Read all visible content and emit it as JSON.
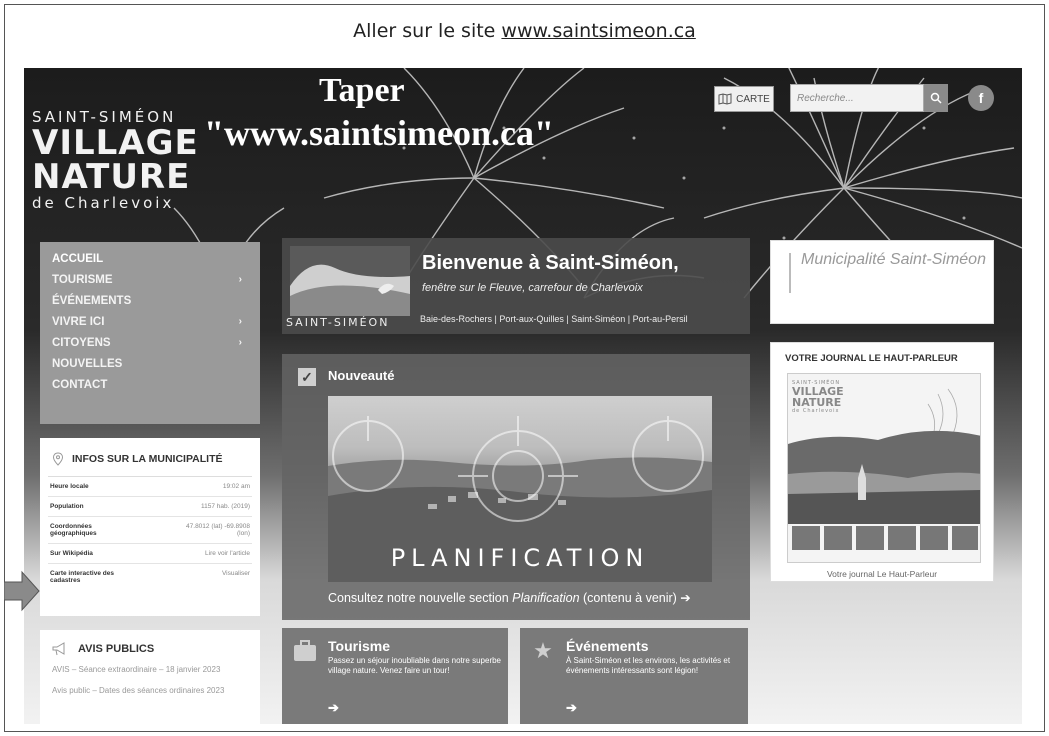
{
  "instruction": {
    "prefix": "Aller sur le site",
    "url": "www.saintsimeon.ca"
  },
  "overlay": {
    "taper": "Taper",
    "taper_url": "\"www.saintsimeon.ca\""
  },
  "logo": {
    "top": "SAINT-SIMÉON",
    "line1": "VILLAGE",
    "line2": "NATURE",
    "bottom": "de Charlevoix"
  },
  "header": {
    "carte_label": "CARTE",
    "search_placeholder": "Recherche...",
    "facebook_label": "f"
  },
  "nav": {
    "items": [
      {
        "label": "ACCUEIL",
        "arrow": ""
      },
      {
        "label": "TOURISME",
        "arrow": "›"
      },
      {
        "label": "ÉVÉNEMENTS",
        "arrow": ""
      },
      {
        "label": "VIVRE ICI",
        "arrow": "›"
      },
      {
        "label": "CITOYENS",
        "arrow": "›"
      },
      {
        "label": "NOUVELLES",
        "arrow": ""
      },
      {
        "label": "CONTACT",
        "arrow": ""
      }
    ]
  },
  "infos": {
    "title": "INFOS SUR LA MUNICIPALITÉ",
    "rows": [
      {
        "key": "Heure locale",
        "value": "19:02 am"
      },
      {
        "key": "Population",
        "value": "1157 hab. (2019)"
      },
      {
        "key": "Coordonnées géographiques",
        "value": "47.8012 (lat) -69.8908 (lon)"
      },
      {
        "key": "Sur Wikipédia",
        "value": "Lire voir l'article"
      },
      {
        "key": "Carte interactive des cadastres",
        "value": "Visualiser"
      }
    ]
  },
  "avis": {
    "title": "AVIS PUBLICS",
    "items": [
      "AVIS – Séance extraordinaire – 18 janvier 2023",
      "Avis public – Dates des séances ordinaires 2023"
    ]
  },
  "welcome": {
    "logo_text": "SAINT-SIMÉON",
    "title": "Bienvenue à Saint-Siméon,",
    "subtitle": "fenêtre sur le Fleuve, carrefour de Charlevoix",
    "places": "Baie-des-Rochers | Port-aux-Quilles | Saint-Siméon | Port-au-Persil"
  },
  "nouveaute": {
    "title": "Nouveauté",
    "image_text": "PLANIFICATION",
    "caption_prefix": "Consultez notre nouvelle section ",
    "caption_italic": "Planification",
    "caption_suffix": " (contenu à venir) ➔"
  },
  "tiles": {
    "tourisme": {
      "title": "Tourisme",
      "text": "Passez un séjour inoubliable dans notre superbe village nature. Venez faire un tour!",
      "arrow": "➔"
    },
    "evenements": {
      "title": "Événements",
      "text": "À Saint-Siméon et les environs, les activités et événements intéressants sont légion!",
      "arrow": "➔"
    }
  },
  "right": {
    "muni_title": "Municipalité Saint-Siméon",
    "journal_title": "VOTRE JOURNAL LE HAUT-PARLEUR",
    "journal_caption": "Votre journal Le Haut-Parleur",
    "cover_logo": {
      "top": "SAINT-SIMÉON",
      "line1": "VILLAGE",
      "line2": "NATURE",
      "bottom": "de Charlevoix"
    }
  },
  "colors": {
    "nav_bg": "#9a9a9a",
    "tile_bg": "#7a7a7a",
    "welcome_bg": "#4b4b4b"
  }
}
